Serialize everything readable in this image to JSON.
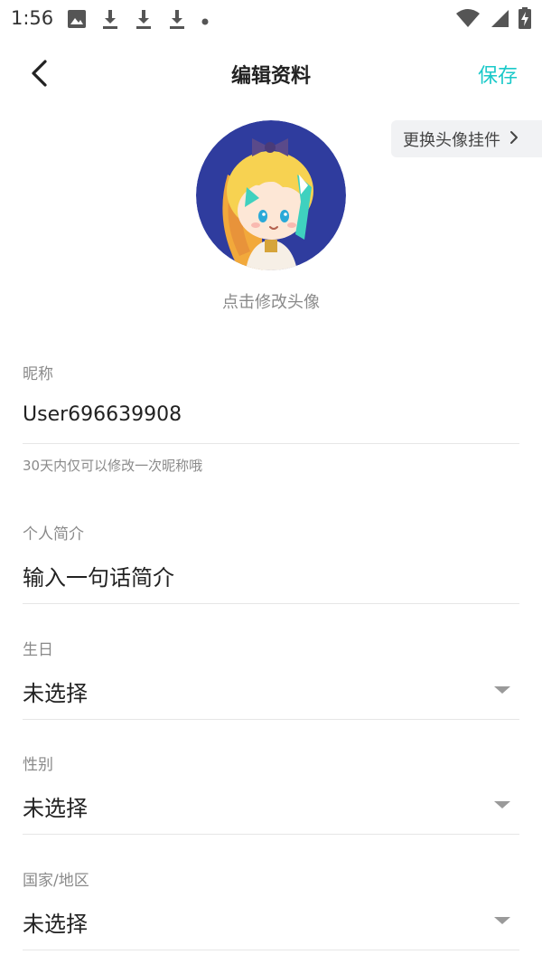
{
  "status_bar": {
    "time": "1:56",
    "left_icons": [
      "image-icon",
      "download-icon",
      "download-icon",
      "download-icon",
      "dot-icon"
    ],
    "right_icons": [
      "wifi-icon",
      "cellular-signal-icon",
      "battery-charging-icon"
    ]
  },
  "header": {
    "back_icon": "back-arrow-icon",
    "title": "编辑资料",
    "save_label": "保存",
    "accent_color": "#1ac9c9"
  },
  "avatar": {
    "change_pendant_label": "更换头像挂件",
    "hint": "点击修改头像"
  },
  "fields": {
    "nickname": {
      "label": "昵称",
      "value": "User696639908",
      "note": "30天内仅可以修改一次昵称哦"
    },
    "bio": {
      "label": "个人简介",
      "placeholder": "输入一句话简介"
    },
    "birthday": {
      "label": "生日",
      "value": "未选择"
    },
    "gender": {
      "label": "性别",
      "value": "未选择"
    },
    "region": {
      "label": "国家/地区",
      "value": "未选择"
    }
  }
}
